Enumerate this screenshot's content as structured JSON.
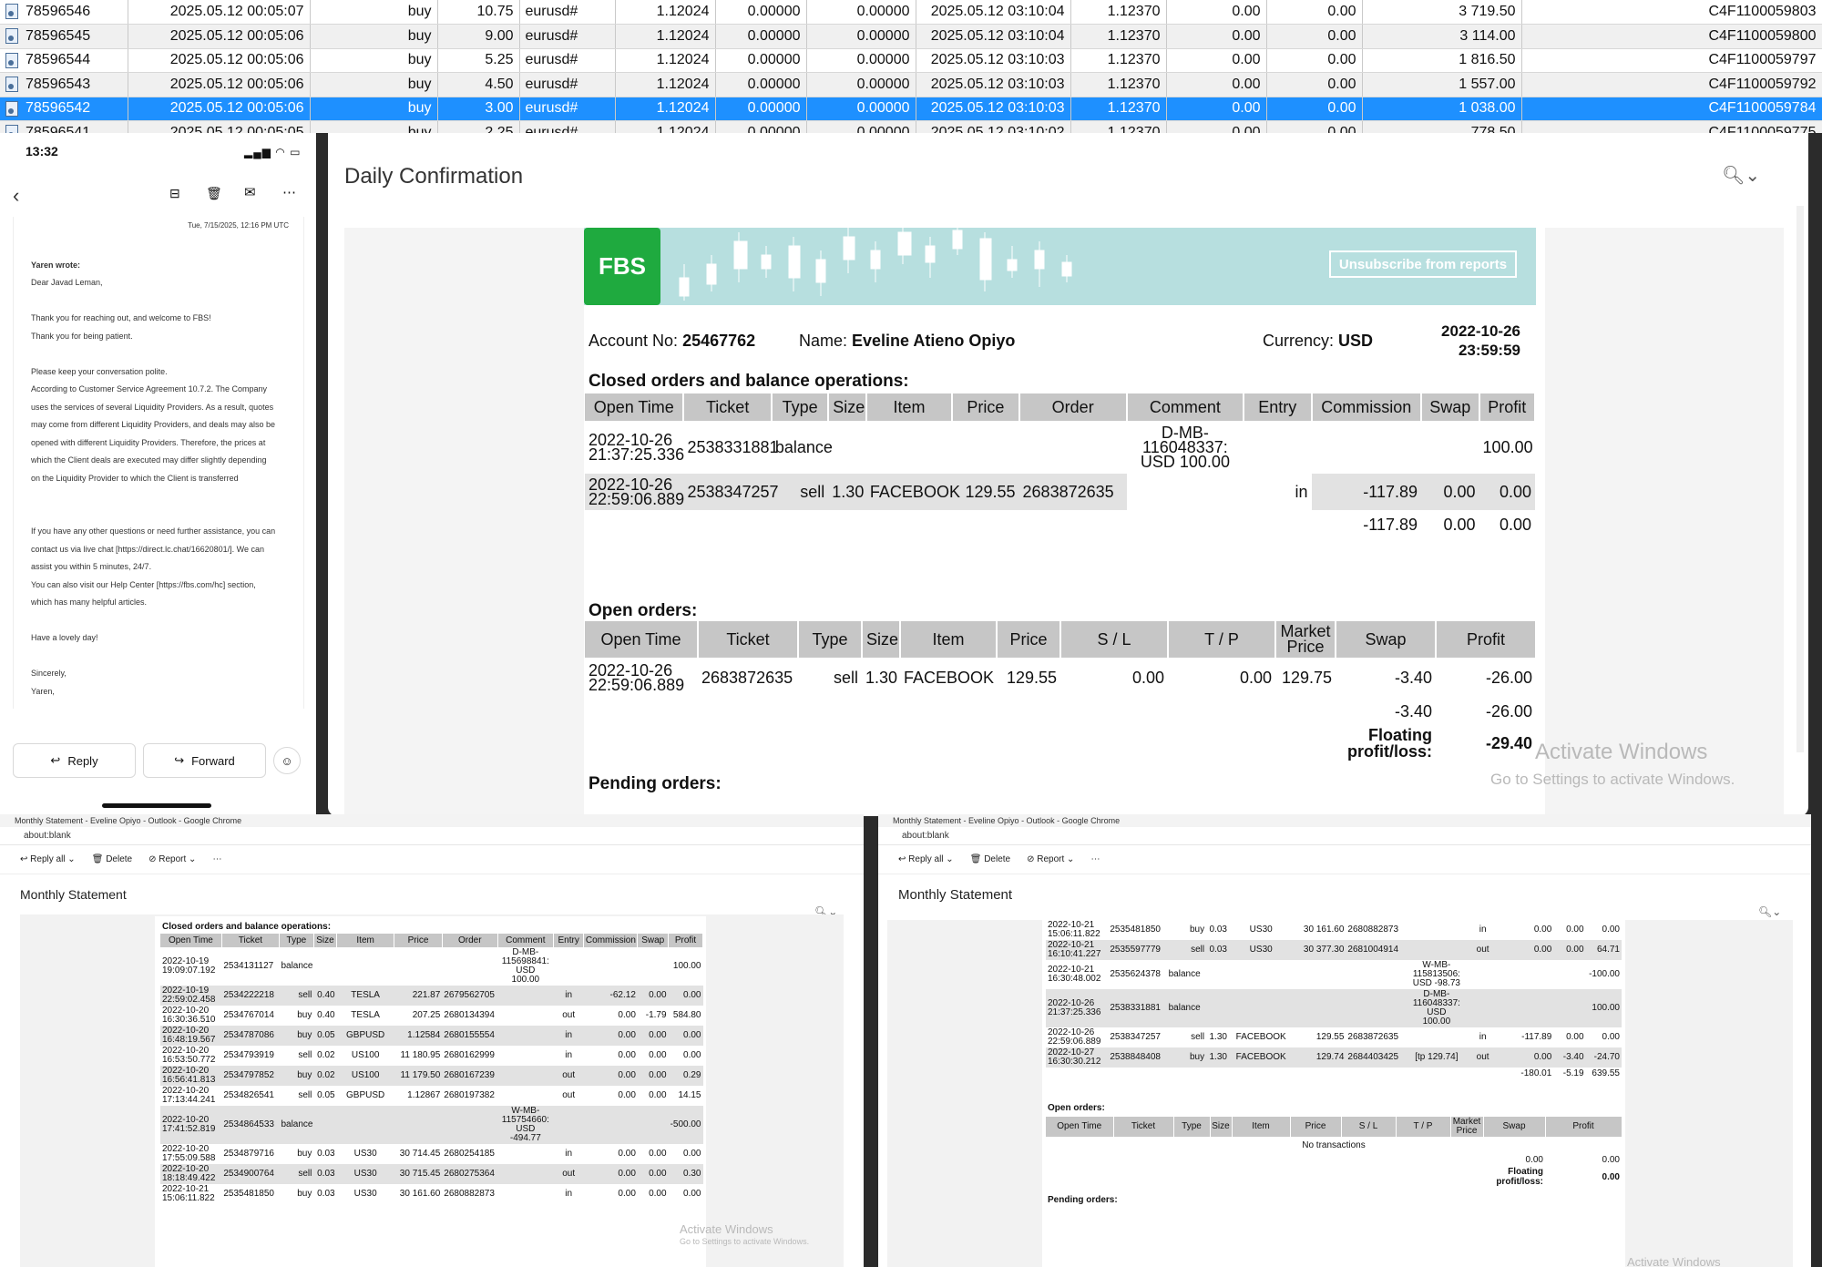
{
  "trades": {
    "rows": [
      {
        "ticket": "78596546",
        "open": "2025.05.12 00:05:07",
        "type": "buy",
        "size": "10.75",
        "symbol": "eurusd#",
        "price": "1.12024",
        "sl": "0.00000",
        "tp": "0.00000",
        "close": "2025.05.12 03:10:04",
        "cprice": "1.12370",
        "comm": "0.00",
        "swap": "0.00",
        "profit": "3 719.50",
        "id": "C4F1100059803"
      },
      {
        "ticket": "78596545",
        "open": "2025.05.12 00:05:06",
        "type": "buy",
        "size": "9.00",
        "symbol": "eurusd#",
        "price": "1.12024",
        "sl": "0.00000",
        "tp": "0.00000",
        "close": "2025.05.12 03:10:04",
        "cprice": "1.12370",
        "comm": "0.00",
        "swap": "0.00",
        "profit": "3 114.00",
        "id": "C4F1100059800"
      },
      {
        "ticket": "78596544",
        "open": "2025.05.12 00:05:06",
        "type": "buy",
        "size": "5.25",
        "symbol": "eurusd#",
        "price": "1.12024",
        "sl": "0.00000",
        "tp": "0.00000",
        "close": "2025.05.12 03:10:03",
        "cprice": "1.12370",
        "comm": "0.00",
        "swap": "0.00",
        "profit": "1 816.50",
        "id": "C4F1100059797"
      },
      {
        "ticket": "78596543",
        "open": "2025.05.12 00:05:06",
        "type": "buy",
        "size": "4.50",
        "symbol": "eurusd#",
        "price": "1.12024",
        "sl": "0.00000",
        "tp": "0.00000",
        "close": "2025.05.12 03:10:03",
        "cprice": "1.12370",
        "comm": "0.00",
        "swap": "0.00",
        "profit": "1 557.00",
        "id": "C4F1100059792"
      },
      {
        "ticket": "78596542",
        "open": "2025.05.12 00:05:06",
        "type": "buy",
        "size": "3.00",
        "symbol": "eurusd#",
        "price": "1.12024",
        "sl": "0.00000",
        "tp": "0.00000",
        "close": "2025.05.12 03:10:03",
        "cprice": "1.12370",
        "comm": "0.00",
        "swap": "0.00",
        "profit": "1 038.00",
        "id": "C4F1100059784"
      },
      {
        "ticket": "78596541",
        "open": "2025.05.12 00:05:05",
        "type": "buy",
        "size": "2.25",
        "symbol": "eurusd#",
        "price": "1.12024",
        "sl": "0.00000",
        "tp": "0.00000",
        "close": "2025.05.12 03:10:02",
        "cprice": "1.12370",
        "comm": "0.00",
        "swap": "0.00",
        "profit": "778.50",
        "id": "C4F1100059775"
      }
    ]
  },
  "phone": {
    "time": "13:32",
    "date": "Tue, 7/15/2025, 12:16 PM UTC",
    "from": "Yaren wrote:",
    "lines": [
      "Dear Javad Leman,",
      "",
      "Thank you for reaching out, and welcome to FBS!",
      "Thank you for being patient.",
      "",
      "Please keep your conversation polite.",
      "According to Customer Service Agreement 10.7.2. The Company",
      "uses the services of several Liquidity Providers. As a result, quotes",
      "may come from different Liquidity Providers, and deals may also be",
      "opened with different Liquidity Providers. Therefore, the prices at",
      "which the Client deals are executed may differ slightly depending",
      "on the Liquidity Provider to which the Client is transferred",
      "",
      "",
      "If you have any other questions or need further assistance, you can",
      "contact us via live chat [https://direct.lc.chat/16620801/]. We can",
      "assist you within 5 minutes, 24/7.",
      "You can also visit our Help Center [https://fbs.com/hc] section,",
      "which has many helpful articles.",
      "",
      "Have a lovely day!",
      "",
      "Sincerely,",
      "Yaren,"
    ],
    "reply": "Reply",
    "forward": "Forward"
  },
  "daily": {
    "title": "Daily Confirmation",
    "logo": "FBS",
    "unsubscribe": "Unsubscribe from reports",
    "account_label": "Account No:",
    "account": "25467762",
    "name_label": "Name:",
    "name": "Eveline Atieno Opiyo",
    "currency_label": "Currency:",
    "currency": "USD",
    "date": "2022-10-26",
    "time": "23:59:59",
    "closed_title": "Closed orders and balance operations:",
    "closed_headers": [
      "Open Time",
      "Ticket",
      "Type",
      "Size",
      "Item",
      "Price",
      "Order",
      "Comment",
      "Entry",
      "Commission",
      "Swap",
      "Profit"
    ],
    "closed_rows": [
      [
        "2022-10-26\n21:37:25.336",
        "2538331881",
        "balance",
        "",
        "",
        "",
        "",
        "D-MB-\n116048337:\nUSD 100.00",
        "",
        "",
        "",
        "100.00"
      ],
      [
        "2022-10-26\n22:59:06.889",
        "2538347257",
        "sell",
        "1.30",
        "FACEBOOK",
        "129.55",
        "2683872635",
        "",
        "in",
        "-117.89",
        "0.00",
        "0.00"
      ]
    ],
    "closed_totals": [
      "-117.89",
      "0.00",
      "0.00"
    ],
    "open_title": "Open orders:",
    "open_headers": [
      "Open Time",
      "Ticket",
      "Type",
      "Size",
      "Item",
      "Price",
      "S / L",
      "T / P",
      "Market\nPrice",
      "Swap",
      "Profit"
    ],
    "open_row": [
      "2022-10-26\n22:59:06.889",
      "2683872635",
      "sell",
      "1.30",
      "FACEBOOK",
      "129.55",
      "0.00",
      "0.00",
      "129.75",
      "-3.40",
      "-26.00"
    ],
    "open_totals": [
      "-3.40",
      "-26.00"
    ],
    "floating_label": "Floating\nprofit/loss:",
    "floating": "-29.40",
    "pending_title": "Pending orders:",
    "watermark1": "Activate Windows",
    "watermark2": "Go to Settings to activate Windows."
  },
  "win_left": {
    "tab": "Monthly Statement - Eveline Opiyo - Outlook - Google Chrome",
    "url": "about:blank",
    "reply_all": "Reply all",
    "delete": "Delete",
    "report": "Report",
    "title": "Monthly Statement",
    "section": "Closed orders and balance operations:",
    "headers": [
      "Open Time",
      "Ticket",
      "Type",
      "Size",
      "Item",
      "Price",
      "Order",
      "Comment",
      "Entry",
      "Commission",
      "Swap",
      "Profit"
    ],
    "rows": [
      [
        "2022-10-19\n19:09:07.192",
        "2534131127",
        "balance",
        "",
        "",
        "",
        "",
        "D-MB-\n115698841:\nUSD\n100.00",
        "",
        "",
        "",
        "100.00"
      ],
      [
        "2022-10-19\n22:59:02.458",
        "2534222218",
        "sell",
        "0.40",
        "TESLA",
        "221.87",
        "2679562705",
        "",
        "in",
        "-62.12",
        "0.00",
        "0.00"
      ],
      [
        "2022-10-20\n16:30:36.510",
        "2534767014",
        "buy",
        "0.40",
        "TESLA",
        "207.25",
        "2680134394",
        "",
        "out",
        "0.00",
        "-1.79",
        "584.80"
      ],
      [
        "2022-10-20\n16:48:19.567",
        "2534787086",
        "buy",
        "0.05",
        "GBPUSD",
        "1.12584",
        "2680155554",
        "",
        "in",
        "0.00",
        "0.00",
        "0.00"
      ],
      [
        "2022-10-20\n16:53:50.772",
        "2534793919",
        "sell",
        "0.02",
        "US100",
        "11 180.95",
        "2680162999",
        "",
        "in",
        "0.00",
        "0.00",
        "0.00"
      ],
      [
        "2022-10-20\n16:56:41.813",
        "2534797852",
        "buy",
        "0.02",
        "US100",
        "11 179.50",
        "2680167239",
        "",
        "out",
        "0.00",
        "0.00",
        "0.29"
      ],
      [
        "2022-10-20\n17:13:44.241",
        "2534826541",
        "sell",
        "0.05",
        "GBPUSD",
        "1.12867",
        "2680197382",
        "",
        "out",
        "0.00",
        "0.00",
        "14.15"
      ],
      [
        "2022-10-20\n17:41:52.819",
        "2534864533",
        "balance",
        "",
        "",
        "",
        "",
        "W-MB-\n115754660:\nUSD\n-494.77",
        "",
        "",
        "",
        "-500.00"
      ],
      [
        "2022-10-20\n17:55:09.588",
        "2534879716",
        "buy",
        "0.03",
        "US30",
        "30 714.45",
        "2680254185",
        "",
        "in",
        "0.00",
        "0.00",
        "0.00"
      ],
      [
        "2022-10-20\n18:18:49.422",
        "2534900764",
        "sell",
        "0.03",
        "US30",
        "30 715.45",
        "2680275364",
        "",
        "out",
        "0.00",
        "0.00",
        "0.30"
      ],
      [
        "2022-10-21\n15:06:11.822",
        "2535481850",
        "buy",
        "0.03",
        "US30",
        "30 161.60",
        "2680882873",
        "",
        "in",
        "0.00",
        "0.00",
        "0.00"
      ]
    ],
    "watermark1": "Activate Windows",
    "watermark2": "Go to Settings to activate Windows."
  },
  "win_right": {
    "tab": "Monthly Statement - Eveline Opiyo - Outlook - Google Chrome",
    "url": "about:blank",
    "reply_all": "Reply all",
    "delete": "Delete",
    "report": "Report",
    "title": "Monthly Statement",
    "rows": [
      [
        "2022-10-21\n15:06:11.822",
        "2535481850",
        "buy",
        "0.03",
        "US30",
        "30 161.60",
        "2680882873",
        "",
        "in",
        "0.00",
        "0.00",
        "0.00"
      ],
      [
        "2022-10-21\n16:10:41.227",
        "2535597779",
        "sell",
        "0.03",
        "US30",
        "30 377.30",
        "2681004914",
        "",
        "out",
        "0.00",
        "0.00",
        "64.71"
      ],
      [
        "2022-10-21\n16:30:48.002",
        "2535624378",
        "balance",
        "",
        "",
        "",
        "",
        "W-MB-\n115813506:\nUSD -98.73",
        "",
        "",
        "",
        "-100.00"
      ],
      [
        "2022-10-26\n21:37:25.336",
        "2538331881",
        "balance",
        "",
        "",
        "",
        "",
        "D-MB-\n116048337:\nUSD\n100.00",
        "",
        "",
        "",
        "100.00"
      ],
      [
        "2022-10-26\n22:59:06.889",
        "2538347257",
        "sell",
        "1.30",
        "FACEBOOK",
        "129.55",
        "2683872635",
        "",
        "in",
        "-117.89",
        "0.00",
        "0.00"
      ],
      [
        "2022-10-27\n16:30:30.212",
        "2538848408",
        "buy",
        "1.30",
        "FACEBOOK",
        "129.74",
        "2684403425",
        "[tp 129.74]",
        "out",
        "0.00",
        "-3.40",
        "-24.70"
      ]
    ],
    "totals": [
      "-180.01",
      "-5.19",
      "639.55"
    ],
    "open_title": "Open orders:",
    "open_headers": [
      "Open Time",
      "Ticket",
      "Type",
      "Size",
      "Item",
      "Price",
      "S / L",
      "T / P",
      "Market\nPrice",
      "Swap",
      "Profit"
    ],
    "no_tx": "No transactions",
    "open_totals": [
      "0.00",
      "0.00"
    ],
    "floating_label": "Floating\nprofit/loss:",
    "floating": "0.00",
    "pending_title": "Pending orders:",
    "watermark1": "Activate Windows"
  }
}
